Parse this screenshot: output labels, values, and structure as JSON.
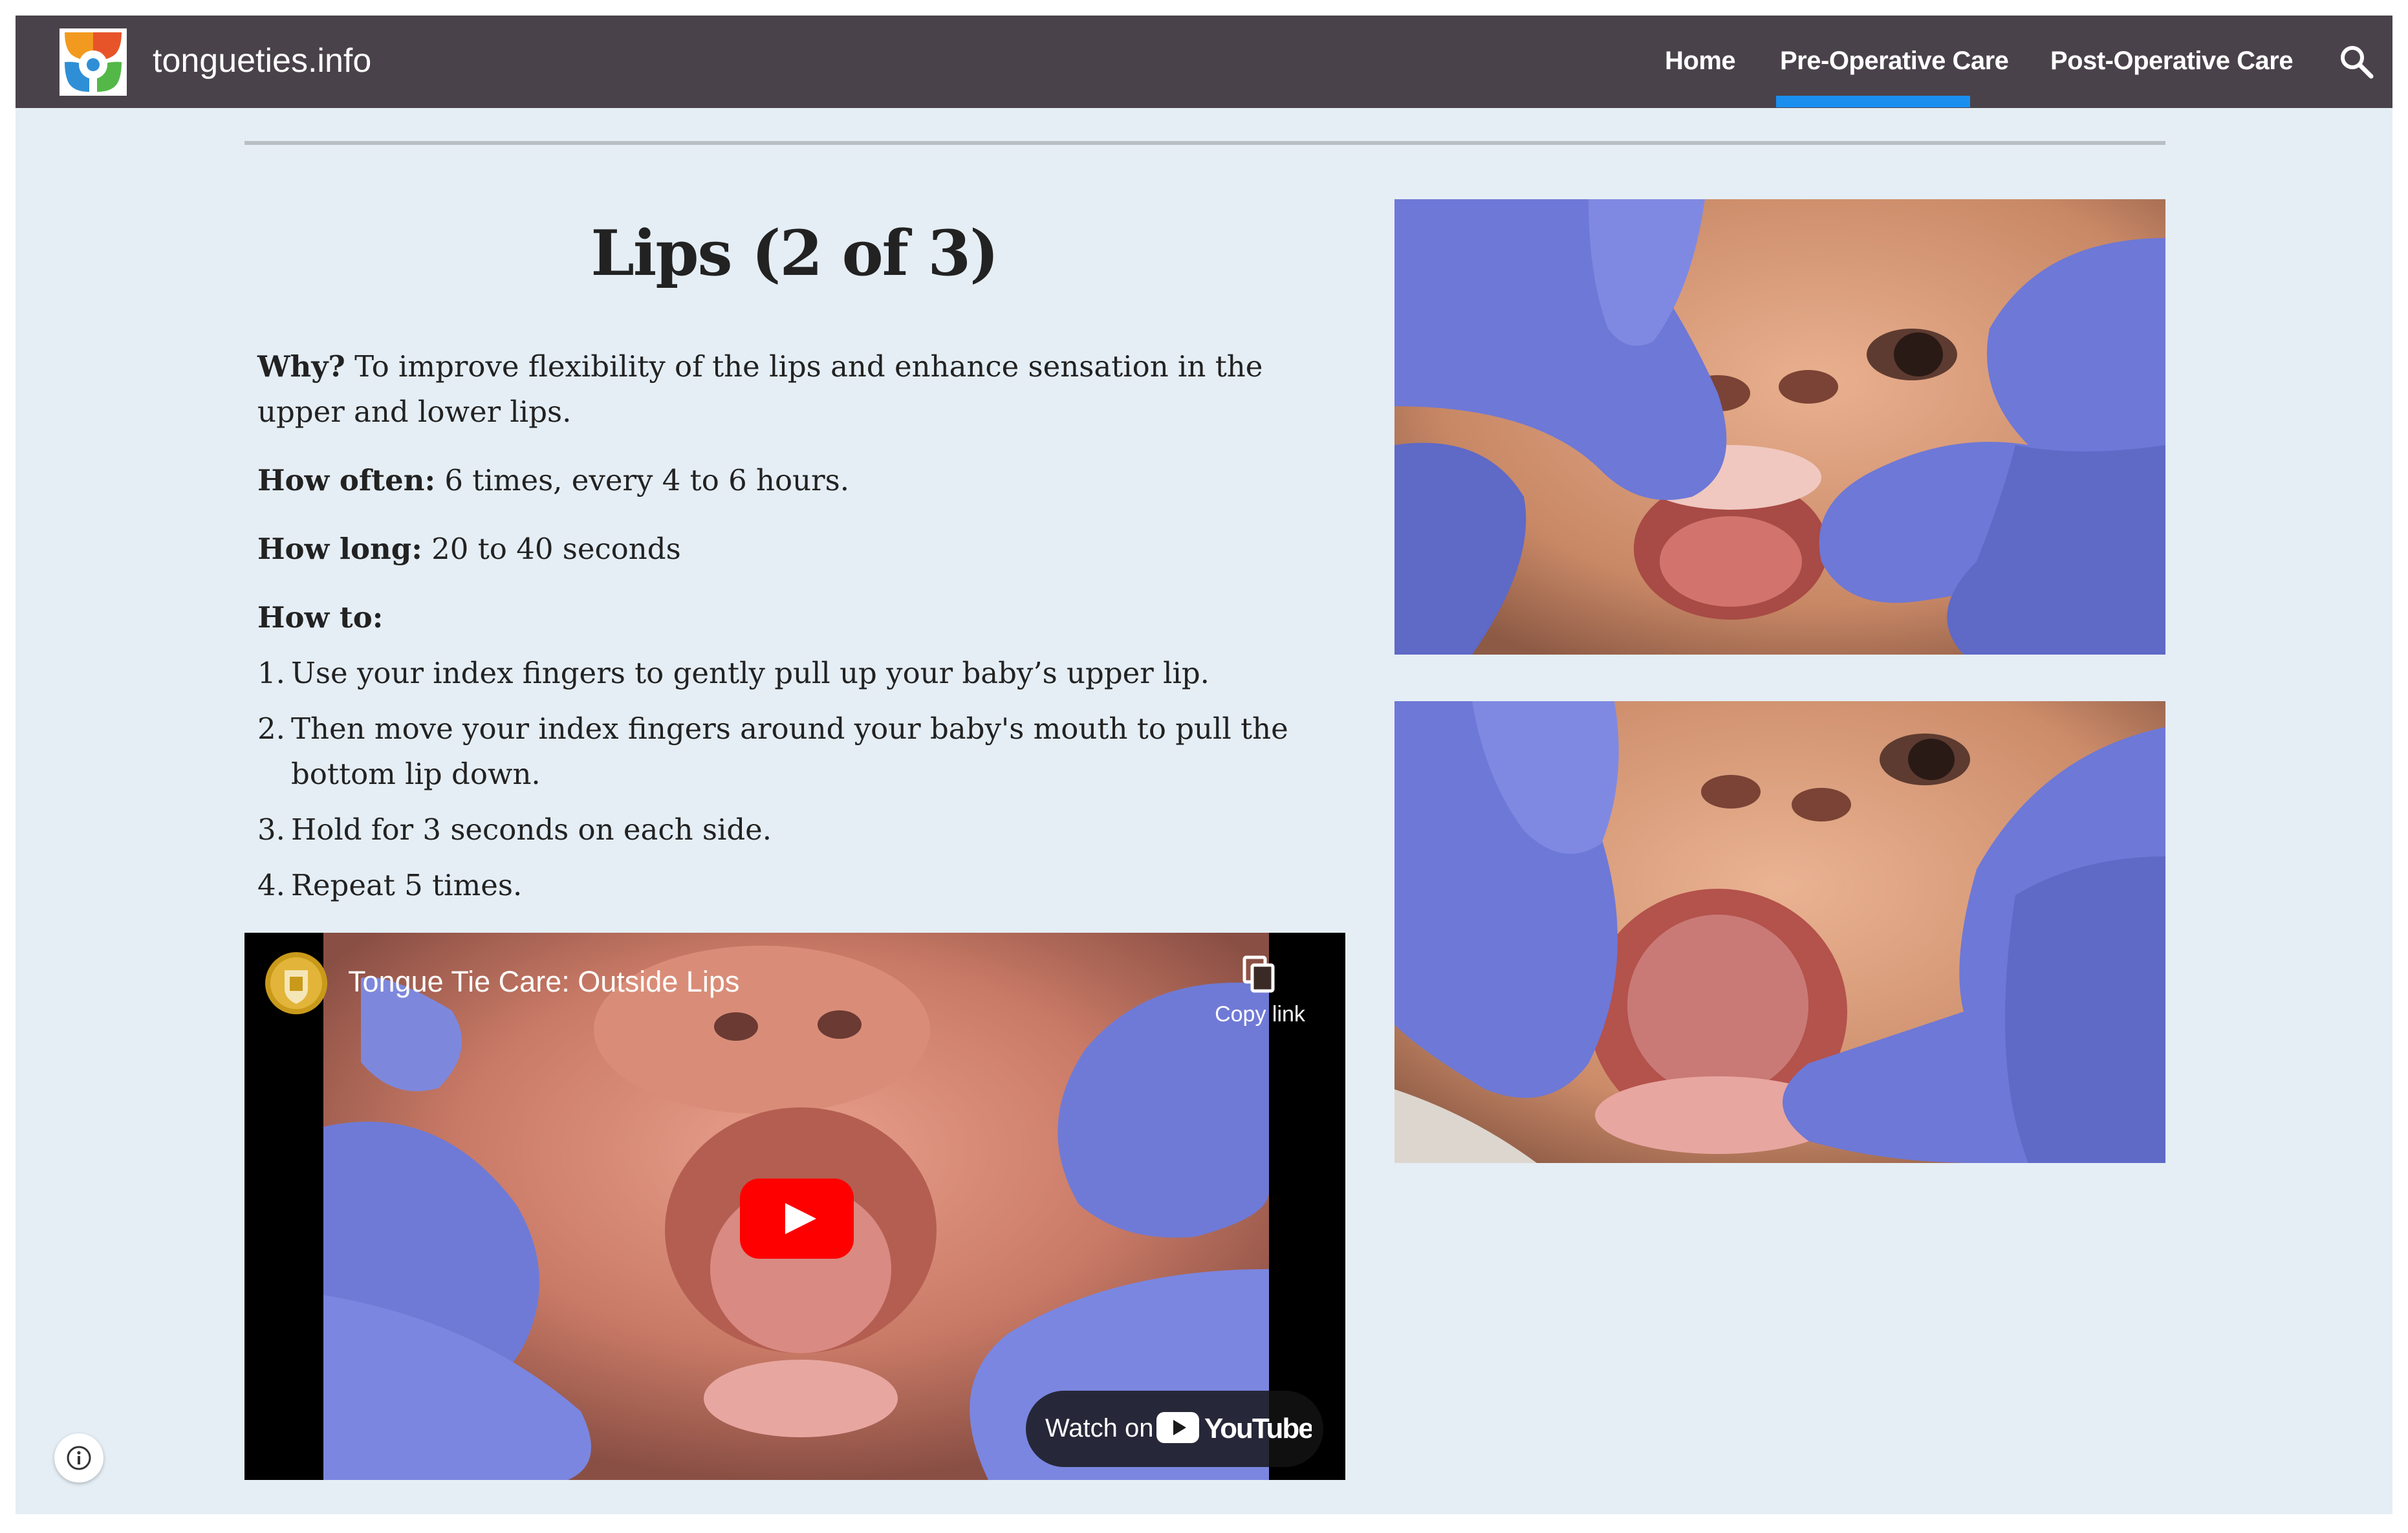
{
  "header": {
    "site_name": "tongueties.info",
    "nav": [
      {
        "label": "Home",
        "active": false
      },
      {
        "label": "Pre-Operative Care",
        "active": true
      },
      {
        "label": "Post-Operative Care",
        "active": false
      }
    ],
    "search_icon": "search-icon",
    "logo_icon": "tongueties-logo",
    "colors": {
      "bar": "#4a424a",
      "active_underline": "#1a8ff0"
    }
  },
  "article": {
    "title": "Lips (2 of 3)",
    "why_label": "Why?",
    "why_text": " To improve flexibility of the lips and enhance sensation in the upper and lower lips.",
    "how_often_label": "How often:",
    "how_often_text": " 6 times, every 4 to 6 hours.",
    "how_long_label": "How long:",
    "how_long_text": " 20 to 40 seconds",
    "how_to_label": "How to:",
    "steps": [
      {
        "num": "1.",
        "text": "Use your index fingers to gently pull up your baby’s upper lip."
      },
      {
        "num": "2.",
        "text": "Then move your index fingers around your baby's mouth to pull the bottom lip down."
      },
      {
        "num": "3.",
        "text": "Hold for 3 seconds on each side."
      },
      {
        "num": "4.",
        "text": "Repeat 5 times."
      }
    ]
  },
  "video": {
    "title": "Tongue Tie Care: Outside Lips",
    "copy_label": "Copy link",
    "watch_label": "Watch on",
    "youtube_label": "YouTube"
  },
  "photos": {
    "top": "photo-gloved-fingers-lifting-upper-lip",
    "bottom": "photo-gloved-fingers-pulling-lower-lip"
  },
  "info_icon": "info-icon"
}
